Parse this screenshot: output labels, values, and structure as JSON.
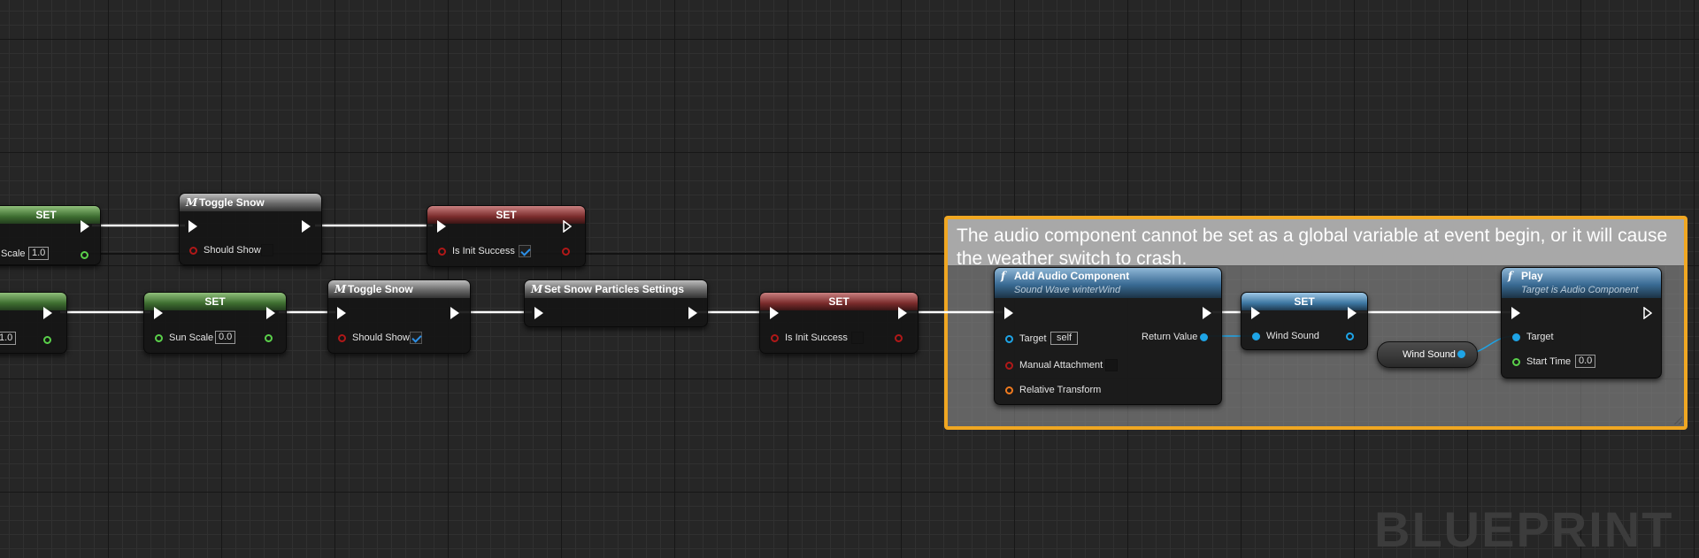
{
  "comment": {
    "text": "The audio component cannot be set as a global variable at event begin, or it will cause the weather switch to crash."
  },
  "watermark": "BLUEPRINT",
  "macro_icon": "M",
  "func_icon": "f",
  "colors": {
    "exec": "#ffffff",
    "bool_pin": "#b01818",
    "float_pin": "#5ad04a",
    "object_pin": "#1ea4e6",
    "transform_pin": "#f07a1e",
    "comment_border": "#f0a722"
  },
  "nodes": {
    "set_partial_top": {
      "title": "SET",
      "pin_label": "Scale",
      "value": "1.0"
    },
    "toggle_snow_1": {
      "title": "Toggle Snow",
      "pin_label": "Should Show",
      "checked": false
    },
    "set_init_1": {
      "title": "SET",
      "pin_label": "Is Init Success",
      "checked": true
    },
    "set_partial_bottom": {
      "value": "1.0"
    },
    "set_sun": {
      "title": "SET",
      "pin_label": "Sun Scale",
      "value": "0.0"
    },
    "toggle_snow_2": {
      "title": "Toggle Snow",
      "pin_label": "Should Show",
      "checked": true
    },
    "snow_particles": {
      "title": "Set Snow Particles Settings"
    },
    "set_init_2": {
      "title": "SET",
      "pin_label": "Is Init Success",
      "checked": false
    },
    "add_audio": {
      "title": "Add Audio Component",
      "subtitle": "Sound Wave winterWind",
      "target_label": "Target",
      "target_value": "self",
      "return_label": "Return Value",
      "manual_label": "Manual Attachment",
      "transform_label": "Relative Transform"
    },
    "set_wind": {
      "title": "SET",
      "pin_label": "Wind Sound"
    },
    "wind_var": {
      "label": "Wind Sound"
    },
    "play": {
      "title": "Play",
      "subtitle": "Target is Audio Component",
      "target_label": "Target",
      "start_label": "Start Time",
      "start_value": "0.0"
    }
  }
}
